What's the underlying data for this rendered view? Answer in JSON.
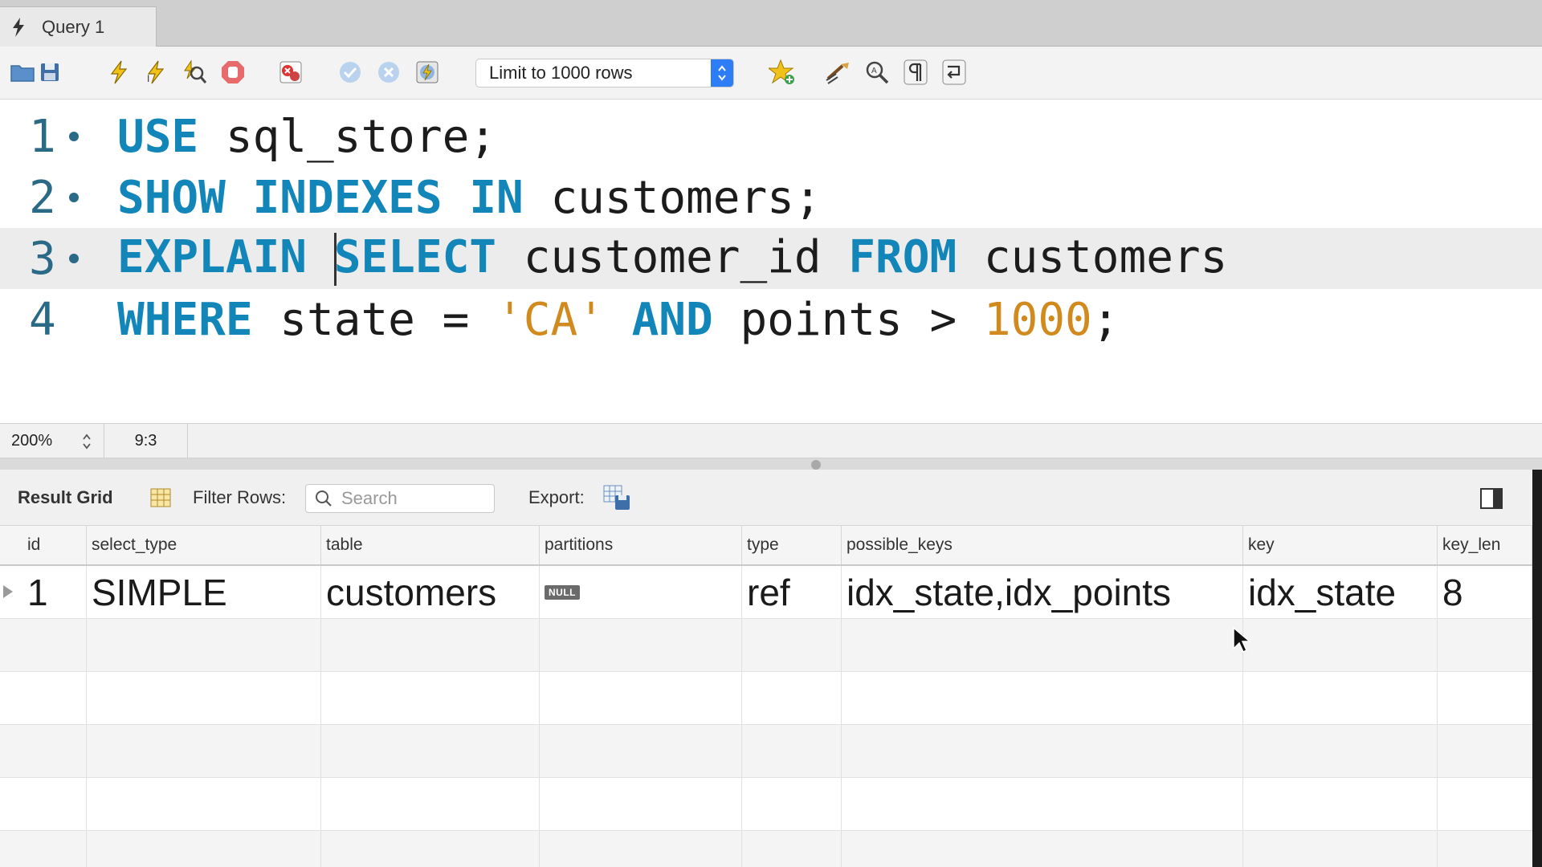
{
  "tab": {
    "label": "Query 1"
  },
  "toolbar": {
    "limit_select": "Limit to 1000 rows",
    "icons": [
      "open-folder-icon",
      "save-icon",
      "execute-icon",
      "execute-current-icon",
      "explain-icon",
      "stop-icon",
      "toggle-error-icon",
      "commit-icon",
      "rollback-icon",
      "autocommit-icon",
      "add-snippet-icon",
      "beautify-icon",
      "find-icon",
      "invisibles-icon",
      "wrap-icon"
    ]
  },
  "editor": {
    "lines": [
      {
        "num": "1",
        "dot": true
      },
      {
        "num": "2",
        "dot": true
      },
      {
        "num": "3",
        "dot": true,
        "current": true
      },
      {
        "num": "4",
        "dot": false
      }
    ],
    "tokens": {
      "l1": [
        "USE",
        " sql_store;"
      ],
      "l2": [
        "SHOW",
        "INDEXES",
        "IN",
        " customers;"
      ],
      "l3": [
        "EXPLAIN",
        "SELECT",
        " customer_id ",
        "FROM",
        " customers"
      ],
      "l4": [
        "WHERE",
        " state = ",
        "'CA'",
        "AND",
        " points > ",
        "1000",
        ";"
      ]
    }
  },
  "status": {
    "zoom": "200%",
    "cursor_pos": "9:3"
  },
  "results": {
    "title": "Result Grid",
    "filter_label": "Filter Rows:",
    "search_placeholder": "Search",
    "export_label": "Export:",
    "columns": [
      "id",
      "select_type",
      "table",
      "partitions",
      "type",
      "possible_keys",
      "key",
      "key_len"
    ],
    "rows": [
      {
        "id": "1",
        "select_type": "SIMPLE",
        "table": "customers",
        "partitions": "NULL",
        "type": "ref",
        "possible_keys": "idx_state,idx_points",
        "key": "idx_state",
        "key_len": "8"
      }
    ]
  },
  "colors": {
    "keyword": "#1386b9",
    "string": "#d08a1e",
    "accent": "#2d7df6"
  }
}
